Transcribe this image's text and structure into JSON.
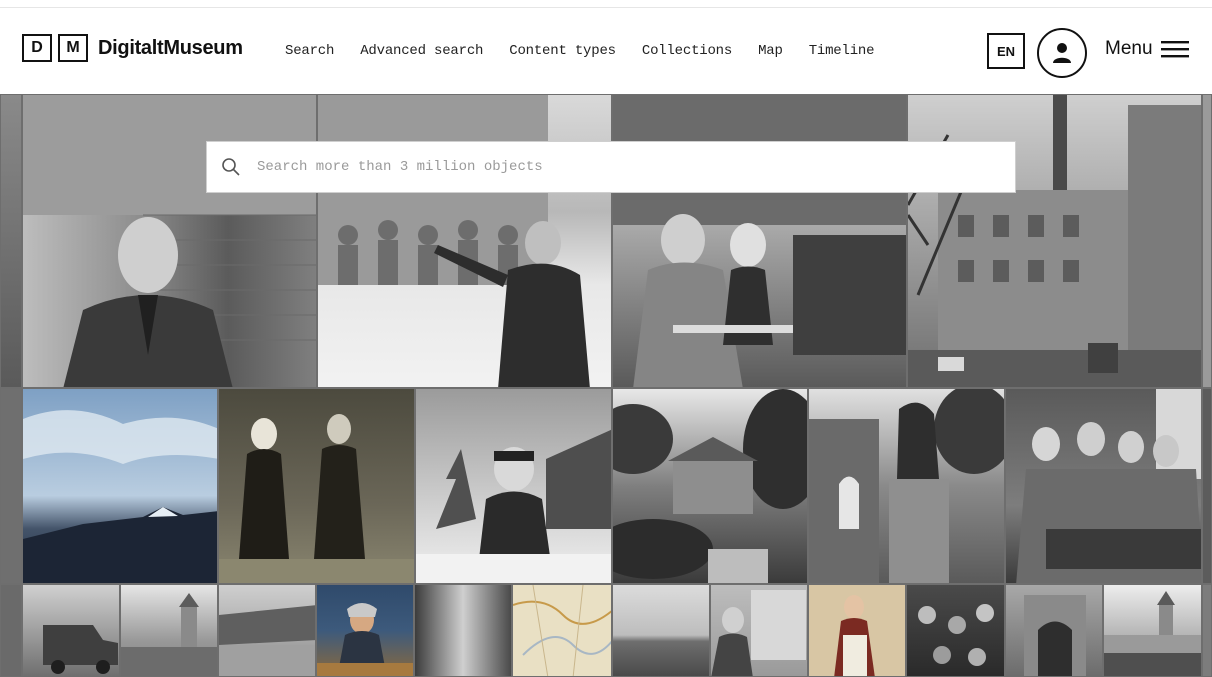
{
  "header": {
    "logo_letters": [
      "D",
      "M"
    ],
    "logo_text": "DigitaltMuseum",
    "nav": [
      {
        "label": "Search"
      },
      {
        "label": "Advanced search"
      },
      {
        "label": "Content types"
      },
      {
        "label": "Collections"
      },
      {
        "label": "Map"
      },
      {
        "label": "Timeline"
      }
    ],
    "language": "EN",
    "menu_label": "Menu"
  },
  "search": {
    "placeholder": "Search more than 3 million objects",
    "icon": "search-icon"
  },
  "icons": {
    "user": "user-icon",
    "menu": "hamburger-icon"
  },
  "colors": {
    "text": "#111111",
    "mosaic_background": "#7a7a7a"
  }
}
